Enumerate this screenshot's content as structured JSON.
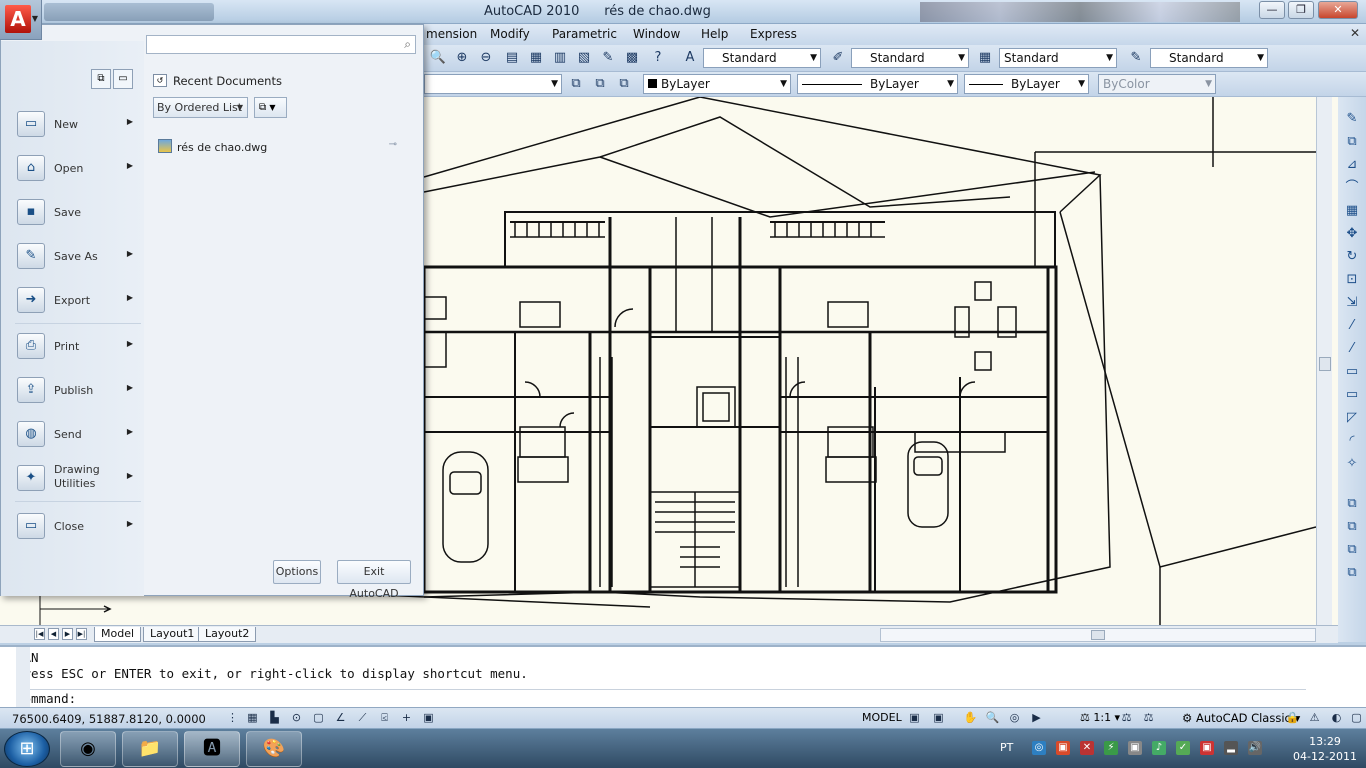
{
  "window": {
    "title": "AutoCAD 2010",
    "document": "rés de chao.dwg",
    "controls": {
      "minimize": "—",
      "maximize": "❐",
      "close": "✕"
    }
  },
  "menubar": {
    "items": [
      "mension",
      "Modify",
      "Parametric",
      "Window",
      "Help",
      "Express"
    ],
    "doc_close": "✕"
  },
  "toolbar1": {
    "text_style": "Standard",
    "dim_style": "Standard",
    "table_style": "Standard",
    "multileader_style": "Standard"
  },
  "toolbar2": {
    "color": "ByLayer",
    "linetype": "ByLayer",
    "lineweight": "ByLayer",
    "plotstyle": "ByColor"
  },
  "app_menu": {
    "search_placeholder": "",
    "items": [
      {
        "label": "New",
        "icon": "new-document-icon",
        "glyph": "▭",
        "arrow": true
      },
      {
        "label": "Open",
        "icon": "open-folder-icon",
        "glyph": "📂",
        "arrow": true
      },
      {
        "label": "Save",
        "icon": "save-disk-icon",
        "glyph": "💾",
        "arrow": false
      },
      {
        "label": "Save As",
        "icon": "save-as-icon",
        "glyph": "✎",
        "arrow": true
      },
      {
        "label": "Export",
        "icon": "export-icon",
        "glyph": "➡",
        "arrow": true
      },
      {
        "label": "Print",
        "icon": "printer-icon",
        "glyph": "🖶",
        "arrow": true
      },
      {
        "label": "Publish",
        "icon": "publish-icon",
        "glyph": "⇪",
        "arrow": true
      },
      {
        "label": "Send",
        "icon": "send-globe-icon",
        "glyph": "🌐",
        "arrow": true
      },
      {
        "label": "Drawing\nUtilities",
        "icon": "drawing-utilities-icon",
        "glyph": "🔧",
        "arrow": true
      },
      {
        "label": "Close",
        "icon": "close-document-icon",
        "glyph": "▭",
        "arrow": true
      }
    ],
    "recent_title": "Recent Documents",
    "sort_label": "By Ordered List",
    "recent_files": [
      "rés de chao.dwg"
    ],
    "options_label": "Options",
    "exit_label": "Exit AutoCAD"
  },
  "tabs": {
    "model": "Model",
    "layout1": "Layout1",
    "layout2": "Layout2"
  },
  "command": {
    "line1": "PAN",
    "line2": "Press ESC or ENTER to exit, or right-click to display shortcut menu.",
    "prompt": "Command:"
  },
  "status": {
    "coords": "76500.6409, 51887.8120, 0.0000",
    "model": "MODEL",
    "annotation_scale": "1:1",
    "workspace": "AutoCAD Classic"
  },
  "taskbar": {
    "language": "PT",
    "time": "13:29",
    "date": "04-12-2011"
  }
}
